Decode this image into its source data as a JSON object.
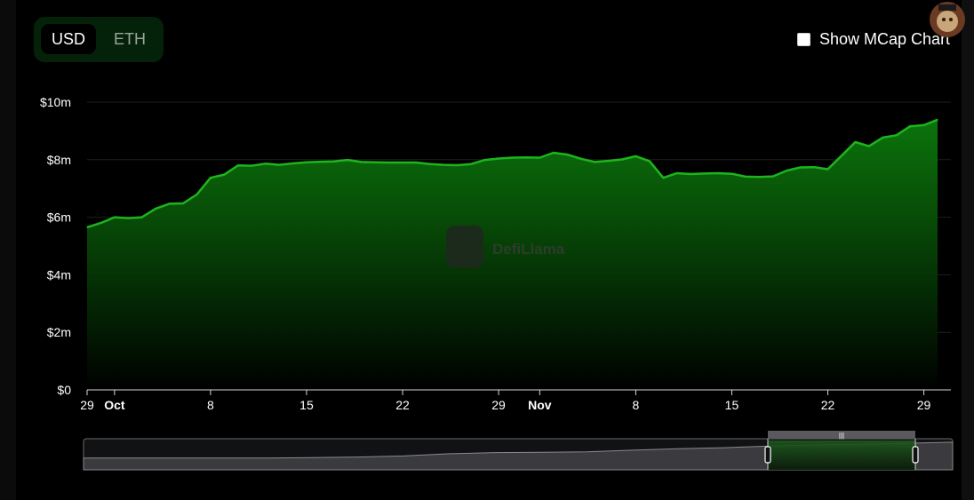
{
  "currency_toggle": {
    "options": [
      "USD",
      "ETH"
    ],
    "selected": "USD"
  },
  "mcap_toggle": {
    "label": "Show MCap Chart",
    "checked": false
  },
  "watermark": {
    "text": "DefiLlama"
  },
  "colors": {
    "accent": "#1db51d",
    "fill_top": "#0c7a0c",
    "fill_bottom": "#000000",
    "toggle_bg": "#04220a"
  },
  "chart_data": {
    "type": "area",
    "title": "",
    "xlabel": "",
    "ylabel": "",
    "ylim": [
      0,
      10000000
    ],
    "yticks": [
      {
        "value": 0,
        "label": "$0"
      },
      {
        "value": 2000000,
        "label": "$2m"
      },
      {
        "value": 4000000,
        "label": "$4m"
      },
      {
        "value": 6000000,
        "label": "$6m"
      },
      {
        "value": 8000000,
        "label": "$8m"
      },
      {
        "value": 10000000,
        "label": "$10m"
      }
    ],
    "xticks": [
      {
        "date": "2024-09-29",
        "label": "29",
        "bold": false
      },
      {
        "date": "2024-10-01",
        "label": "Oct",
        "bold": true
      },
      {
        "date": "2024-10-08",
        "label": "8",
        "bold": false
      },
      {
        "date": "2024-10-15",
        "label": "15",
        "bold": false
      },
      {
        "date": "2024-10-22",
        "label": "22",
        "bold": false
      },
      {
        "date": "2024-10-29",
        "label": "29",
        "bold": false
      },
      {
        "date": "2024-11-01",
        "label": "Nov",
        "bold": true
      },
      {
        "date": "2024-11-08",
        "label": "8",
        "bold": false
      },
      {
        "date": "2024-11-15",
        "label": "15",
        "bold": false
      },
      {
        "date": "2024-11-22",
        "label": "22",
        "bold": false
      },
      {
        "date": "2024-11-29",
        "label": "29",
        "bold": false
      }
    ],
    "grid": true,
    "series": [
      {
        "x": [
          "2024-09-29",
          "2024-09-30",
          "2024-10-01",
          "2024-10-02",
          "2024-10-03",
          "2024-10-04",
          "2024-10-05",
          "2024-10-06",
          "2024-10-07",
          "2024-10-08",
          "2024-10-09",
          "2024-10-10",
          "2024-10-11",
          "2024-10-12",
          "2024-10-13",
          "2024-10-14",
          "2024-10-15",
          "2024-10-16",
          "2024-10-17",
          "2024-10-18",
          "2024-10-19",
          "2024-10-20",
          "2024-10-21",
          "2024-10-22",
          "2024-10-23",
          "2024-10-24",
          "2024-10-25",
          "2024-10-26",
          "2024-10-27",
          "2024-10-28",
          "2024-10-29",
          "2024-10-30",
          "2024-10-31",
          "2024-11-01",
          "2024-11-02",
          "2024-11-03",
          "2024-11-04",
          "2024-11-05",
          "2024-11-06",
          "2024-11-07",
          "2024-11-08",
          "2024-11-09",
          "2024-11-10",
          "2024-11-11",
          "2024-11-12",
          "2024-11-13",
          "2024-11-14",
          "2024-11-15",
          "2024-11-16",
          "2024-11-17",
          "2024-11-18",
          "2024-11-19",
          "2024-11-20",
          "2024-11-21",
          "2024-11-22",
          "2024-11-23",
          "2024-11-24",
          "2024-11-25",
          "2024-11-26",
          "2024-11-27",
          "2024-11-28",
          "2024-11-29",
          "2024-11-30"
        ],
        "values": [
          5650000,
          5800000,
          6000000,
          5970000,
          6000000,
          6300000,
          6470000,
          6480000,
          6790000,
          7370000,
          7480000,
          7800000,
          7790000,
          7860000,
          7820000,
          7870000,
          7910000,
          7930000,
          7940000,
          7990000,
          7920000,
          7910000,
          7900000,
          7900000,
          7900000,
          7850000,
          7820000,
          7810000,
          7850000,
          7990000,
          8040000,
          8070000,
          8080000,
          8070000,
          8240000,
          8180000,
          8030000,
          7920000,
          7960000,
          8010000,
          8120000,
          7950000,
          7370000,
          7530000,
          7500000,
          7520000,
          7530000,
          7510000,
          7410000,
          7400000,
          7420000,
          7620000,
          7730000,
          7740000,
          7670000,
          8140000,
          8610000,
          8470000,
          8770000,
          8850000,
          9160000,
          9200000,
          9390000
        ]
      }
    ],
    "brush": {
      "overview": [
        3.6,
        3.6,
        3.6,
        3.6,
        3.6,
        3.8,
        4.0,
        4.4,
        5.2,
        5.6,
        5.7,
        5.9,
        6.5,
        7.0,
        7.4,
        8.0,
        8.4,
        8.6,
        9.0,
        9.4
      ],
      "grip": "|||"
    }
  }
}
